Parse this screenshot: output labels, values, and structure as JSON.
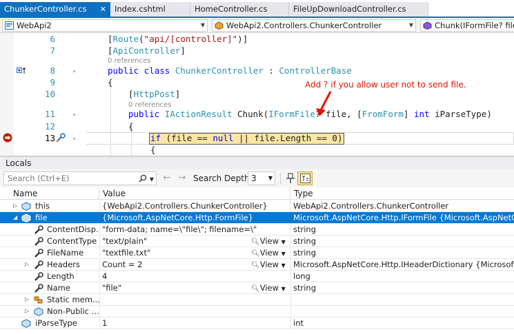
{
  "tabs": [
    {
      "label": "ChunkerController.cs",
      "close": "✕",
      "active": true
    },
    {
      "label": "Index.cshtml"
    },
    {
      "label": "HomeController.cs"
    },
    {
      "label": "FileUpDownloadController.cs"
    }
  ],
  "navbar": {
    "project": "WebApi2",
    "class": "WebApi2.Controllers.ChunkerController",
    "member": "Chunk(IFormFile? file, i"
  },
  "editor": {
    "line_numbers": [
      "6",
      "7",
      "8",
      "9",
      "10",
      "11",
      "12",
      "13"
    ],
    "codelens_1": "0 references",
    "codelens_2": "0 references",
    "annotation": "Add ? if you allow user not to send file.",
    "lines": {
      "l6a": "[",
      "l6b": "Route",
      "l6c": "(",
      "l6d": "\"api/[controller]\"",
      "l6e": ")]",
      "l7a": "[",
      "l7b": "ApiController",
      "l7c": "]",
      "l8a": "public class ",
      "l8b": "ChunkerController",
      "l8c": " : ",
      "l8d": "ControllerBase",
      "l9": "{",
      "l10a": "[",
      "l10b": "HttpPost",
      "l10c": "]",
      "l11a": "public ",
      "l11b": "IActionResult",
      "l11c": " Chunk(",
      "l11d": "IFormFile",
      "l11e": "? file, [",
      "l11f": "FromForm",
      "l11g": "] ",
      "l11h": "int",
      "l11i": " iParseType)",
      "l12": "{",
      "l13a": "if",
      "l13b": " (file == ",
      "l13c": "null",
      "l13d": " || file.Length == 0)",
      "l14": "{"
    }
  },
  "locals": {
    "title": "Locals",
    "search_placeholder": "Search (Ctrl+E)",
    "search_depth_label": "Search Depth:",
    "search_depth_value": "3",
    "columns": {
      "name": "Name",
      "value": "Value",
      "type": "Type"
    },
    "view_label": "View",
    "rows": [
      {
        "name": "this",
        "value": "{WebApi2.Controllers.ChunkerController}",
        "type": "WebApi2.Controllers.ChunkerController"
      },
      {
        "name": "file",
        "value": "{Microsoft.AspNetCore.Http.FormFile}",
        "type": "Microsoft.AspNetCore.Http.IFormFile {Microsoft.AspNetCore.Http"
      },
      {
        "name": "ContentDisp...",
        "value": "\"form-data; name=\\\"file\\\"; filename=\\\"",
        "type": "string"
      },
      {
        "name": "ContentType",
        "value": "\"text/plain\"",
        "type": "string"
      },
      {
        "name": "FileName",
        "value": "\"textfile.txt\"",
        "type": "string"
      },
      {
        "name": "Headers",
        "value": "Count = 2",
        "type": "Microsoft.AspNetCore.Http.IHeaderDictionary {Microsoft.Asp"
      },
      {
        "name": "Length",
        "value": "4",
        "type": "long"
      },
      {
        "name": "Name",
        "value": "\"file\"",
        "type": "string"
      },
      {
        "name": "Static mem...",
        "value": "",
        "type": ""
      },
      {
        "name": "Non-Public ...",
        "value": "",
        "type": ""
      },
      {
        "name": "iParseType",
        "value": "1",
        "type": "int"
      }
    ]
  },
  "colors": {
    "accent": "#0e70c0",
    "selection": "#0078d7",
    "annotation": "#e51400",
    "highlight": "#fbe6a3"
  }
}
